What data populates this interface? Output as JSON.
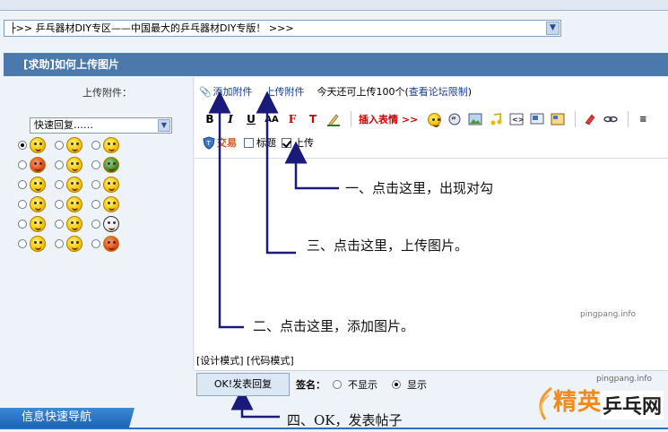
{
  "breadcrumb": {
    "select_value": "├>> 乒乓器材DIY专区——中国最大的乒乓器材DIY专版！  >>>"
  },
  "thread": {
    "title": "[求助]如何上传图片"
  },
  "attach": {
    "label": "上传附件：",
    "add_link": "添加附件",
    "upload_link": "上传附件",
    "remaining": "今天还可上传100个(",
    "limit_link": "查看论坛限制",
    "close": ")"
  },
  "quick_reply": {
    "select_value": "快速回复……"
  },
  "editor": {
    "insert_emoticon": "插入表情 >>",
    "trade": "交易",
    "title_checkbox": "标题",
    "upload_checkbox": "上传",
    "design_mode": "[设计模式]",
    "code_mode": "[代码模式]"
  },
  "annotations": {
    "step1": "一、点击这里，出现对勾",
    "step2": "二、点击这里，添加图片。",
    "step3": "三、点击这里，上传图片。",
    "step4": "四、OK，发表帖子"
  },
  "watermark": "pingpang.info",
  "reply_button": "OK!发表回复",
  "signature": {
    "label": "签名：",
    "hide": "不显示",
    "show": "显示"
  },
  "nav": {
    "quick_nav": "信息快速导航"
  },
  "logo": {
    "site": "pingpang.info",
    "jy": "精英",
    "pp": "乒乓网"
  },
  "colors": {
    "title_bar": "#4b79ab",
    "arrow": "#1a1a7a",
    "emoticon_link": "#cc0000",
    "logo_orange": "#f08a1a"
  }
}
